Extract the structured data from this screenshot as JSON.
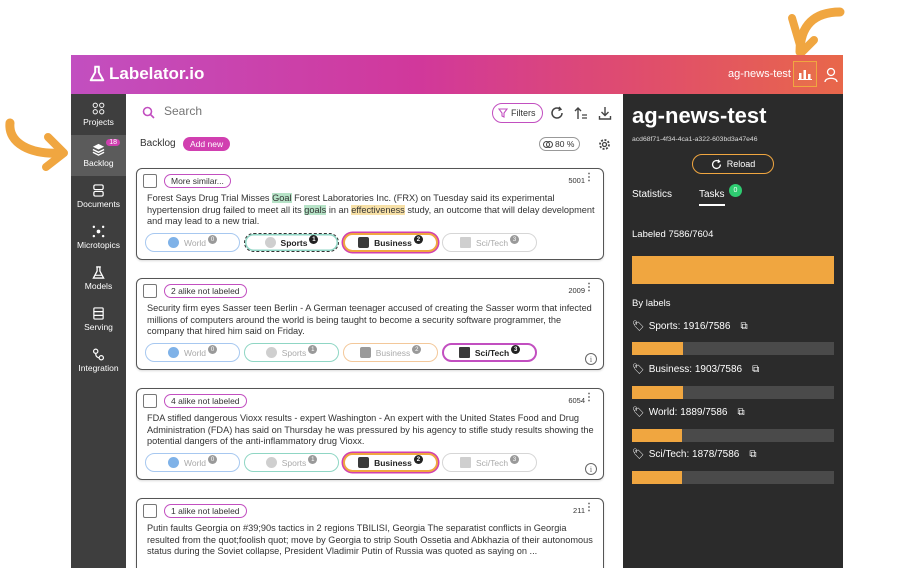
{
  "app": {
    "logo_text": "Labelator.io",
    "project_name": "ag-news-test"
  },
  "colors": {
    "accent": "#c24fc0",
    "orange": "#f0a640",
    "panel": "#2b2b2b",
    "sidebar": "#3e3e3e"
  },
  "sidebar": {
    "items": [
      {
        "label": "Projects",
        "icon": "grid-icon"
      },
      {
        "label": "Backlog",
        "icon": "layers-icon",
        "badge": "18"
      },
      {
        "label": "Documents",
        "icon": "documents-icon"
      },
      {
        "label": "Microtopics",
        "icon": "microtopics-icon"
      },
      {
        "label": "Models",
        "icon": "flask-icon"
      },
      {
        "label": "Serving",
        "icon": "server-icon"
      },
      {
        "label": "Integration",
        "icon": "integration-icon"
      }
    ]
  },
  "toolbar": {
    "search_placeholder": "Search",
    "filters_label": "Filters",
    "backlog_label": "Backlog",
    "add_new_label": "Add new",
    "percent_label": "80 %"
  },
  "cards": [
    {
      "similar_label": "More similar...",
      "count": "5001",
      "text_parts": [
        "Forest Says Drug Trial Misses ",
        "Goal",
        " Forest Laboratories Inc. (FRX) on Tuesday said its experimental hypertension drug failed to meet all its ",
        "goals",
        " in an ",
        "effectiveness",
        " study, an outcome that will delay development and may lead to a new trial."
      ],
      "labels": [
        {
          "name": "World",
          "key": "0"
        },
        {
          "name": "Sports",
          "key": "1"
        },
        {
          "name": "Business",
          "key": "2"
        },
        {
          "name": "Sci/Tech",
          "key": "3"
        }
      ]
    },
    {
      "similar_label": "2 alike not labeled",
      "count": "2009",
      "text": "Security firm eyes Sasser teen Berlin - A German teenager accused of creating the Sasser worm that infected millions of computers around the world is being taught to become a security software programmer, the company that hired him said on Friday.",
      "labels": [
        {
          "name": "World",
          "key": "0"
        },
        {
          "name": "Sports",
          "key": "1"
        },
        {
          "name": "Business",
          "key": "2"
        },
        {
          "name": "Sci/Tech",
          "key": "3"
        }
      ]
    },
    {
      "similar_label": "4 alike not labeled",
      "count": "6054",
      "text": "FDA stifled dangerous Vioxx results - expert Washington - An expert with the United States Food and Drug Administration (FDA) has said on Thursday he was pressured by his agency to stifle study results showing the potential dangers of the anti-inflammatory drug Vioxx.",
      "labels": [
        {
          "name": "World",
          "key": "0"
        },
        {
          "name": "Sports",
          "key": "1"
        },
        {
          "name": "Business",
          "key": "2"
        },
        {
          "name": "Sci/Tech",
          "key": "3"
        }
      ]
    },
    {
      "similar_label": "1 alike not labeled",
      "count": "211",
      "text": "Putin faults Georgia on #39;90s tactics in 2 regions TBILISI, Georgia The separatist conflicts in Georgia resulted from the quot;foolish quot; move by Georgia to strip South Ossetia and Abkhazia of their autonomous status during the Soviet collapse, President Vladimir Putin of Russia was quoted as saying on ..."
    }
  ],
  "right_panel": {
    "title": "ag-news-test",
    "id": "acd68f71-4f34-4ca1-a322-603bd3a47e46",
    "reload_label": "Reload",
    "tab_statistics": "Statistics",
    "tab_tasks": "Tasks",
    "tasks_badge": "0",
    "labeled_text": "Labeled 7586/7604",
    "labeled_fraction": 0.998,
    "by_labels_title": "By labels",
    "labels": [
      {
        "text": "Sports: 1916/7586",
        "fraction": 0.253
      },
      {
        "text": "Business: 1903/7586",
        "fraction": 0.251
      },
      {
        "text": "World: 1889/7586",
        "fraction": 0.249
      },
      {
        "text": "Sci/Tech: 1878/7586",
        "fraction": 0.248
      }
    ]
  }
}
